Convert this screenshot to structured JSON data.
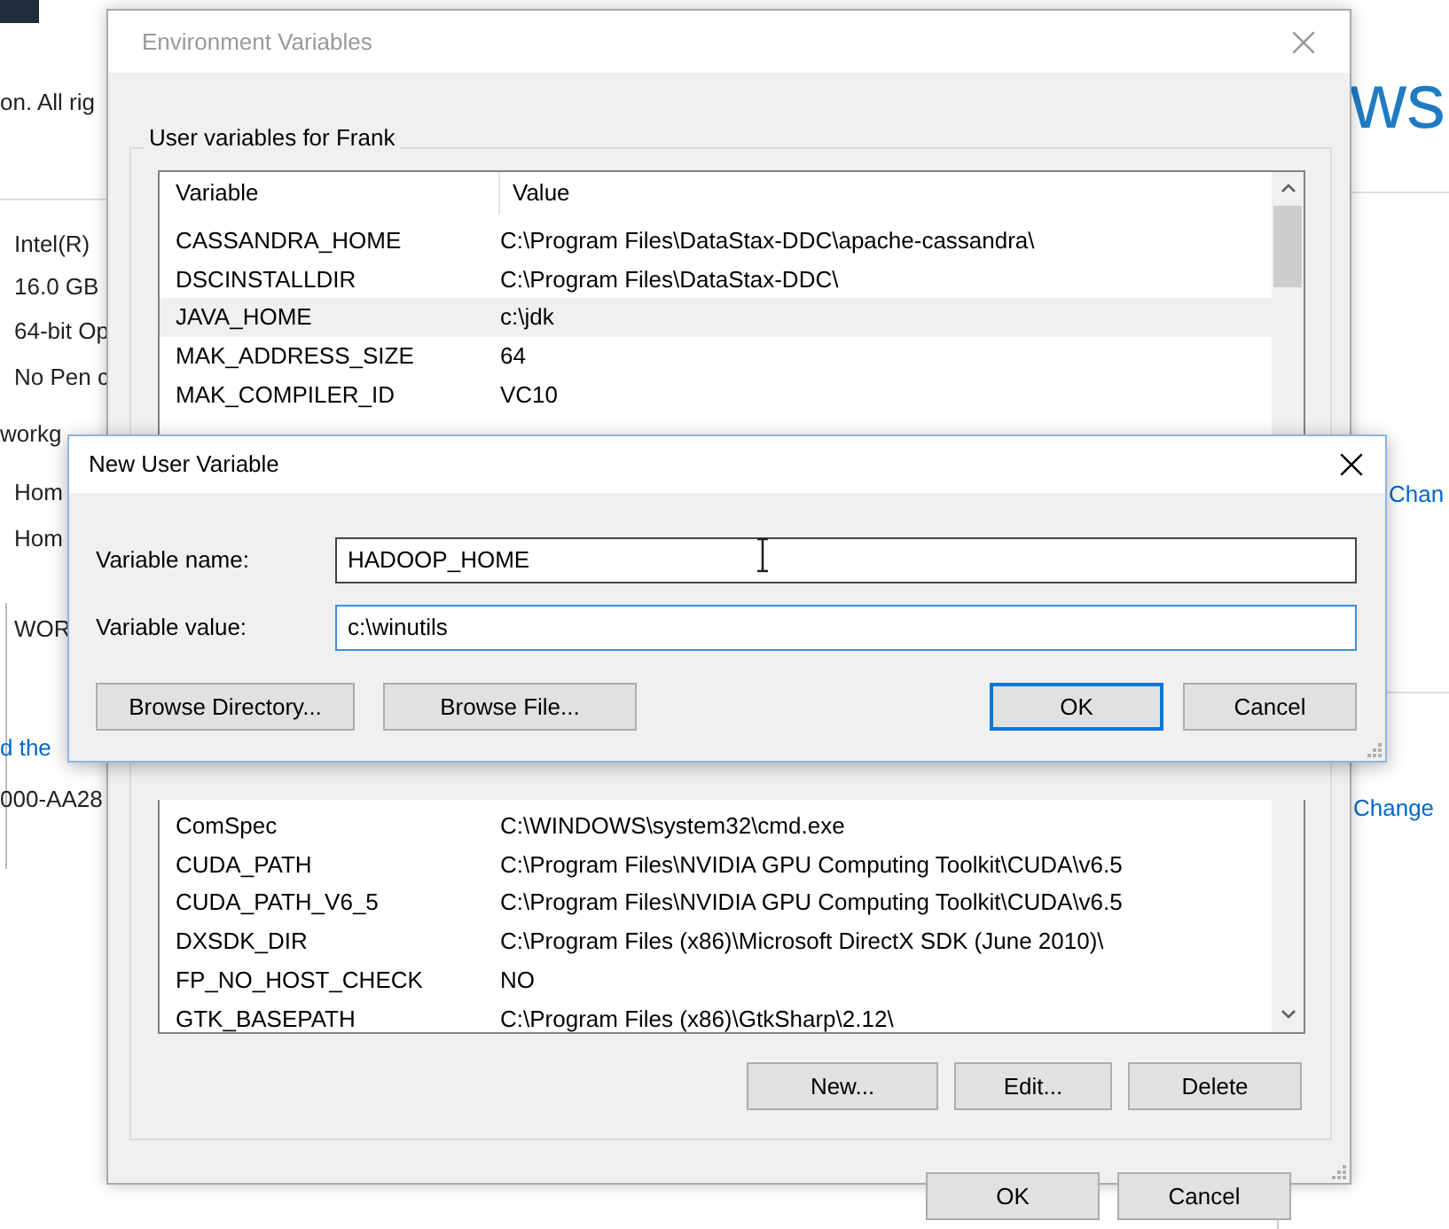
{
  "background_window": {
    "heading": "ws",
    "left_items": [
      {
        "kind": "text",
        "text": "on. All rig"
      },
      {
        "kind": "text",
        "text": "Intel(R)"
      },
      {
        "kind": "text",
        "text": "16.0 GB"
      },
      {
        "kind": "text",
        "text": "64-bit Op"
      },
      {
        "kind": "text",
        "text": "No Pen c"
      },
      {
        "kind": "text",
        "text": "workg"
      },
      {
        "kind": "text",
        "text": "Hom"
      },
      {
        "kind": "text",
        "text": "Hom"
      },
      {
        "kind": "text",
        "text": "WOR"
      },
      {
        "kind": "link",
        "text": "d the"
      },
      {
        "kind": "text",
        "text": "000-AA28"
      }
    ],
    "right_links": [
      "Chan",
      "Change"
    ]
  },
  "environment_dialog": {
    "title": "Environment Variables",
    "group_label": "User variables for Frank",
    "columns": [
      "Variable",
      "Value"
    ],
    "user_variables": [
      {
        "variable": "CASSANDRA_HOME",
        "value": "C:\\Program Files\\DataStax-DDC\\apache-cassandra\\",
        "selected": false
      },
      {
        "variable": "DSCINSTALLDIR",
        "value": "C:\\Program Files\\DataStax-DDC\\",
        "selected": false
      },
      {
        "variable": "JAVA_HOME",
        "value": "c:\\jdk",
        "selected": true
      },
      {
        "variable": "MAK_ADDRESS_SIZE",
        "value": "64",
        "selected": false
      },
      {
        "variable": "MAK_COMPILER_ID",
        "value": "VC10",
        "selected": false
      }
    ],
    "system_variables": [
      {
        "variable": "ComSpec",
        "value": "C:\\WINDOWS\\system32\\cmd.exe",
        "selected": false
      },
      {
        "variable": "CUDA_PATH",
        "value": "C:\\Program Files\\NVIDIA GPU Computing Toolkit\\CUDA\\v6.5",
        "selected": false
      },
      {
        "variable": "CUDA_PATH_V6_5",
        "value": "C:\\Program Files\\NVIDIA GPU Computing Toolkit\\CUDA\\v6.5",
        "selected": false
      },
      {
        "variable": "DXSDK_DIR",
        "value": "C:\\Program Files (x86)\\Microsoft DirectX SDK (June 2010)\\",
        "selected": false
      },
      {
        "variable": "FP_NO_HOST_CHECK",
        "value": "NO",
        "selected": false
      },
      {
        "variable": "GTK_BASEPATH",
        "value": "C:\\Program Files (x86)\\GtkSharp\\2.12\\",
        "selected": false
      }
    ],
    "list_buttons": [
      "New...",
      "Edit...",
      "Delete"
    ],
    "footer_buttons": [
      "OK",
      "Cancel"
    ]
  },
  "new_variable_dialog": {
    "title": "New User Variable",
    "fields": [
      {
        "label": "Variable name:",
        "value": "HADOOP_HOME",
        "focused": false
      },
      {
        "label": "Variable value:",
        "value": "c:\\winutils",
        "focused": true
      }
    ],
    "buttons": [
      {
        "label": "Browse Directory...",
        "default": false
      },
      {
        "label": "Browse File...",
        "default": false
      },
      {
        "label": "OK",
        "default": true
      },
      {
        "label": "Cancel",
        "default": false
      }
    ]
  }
}
